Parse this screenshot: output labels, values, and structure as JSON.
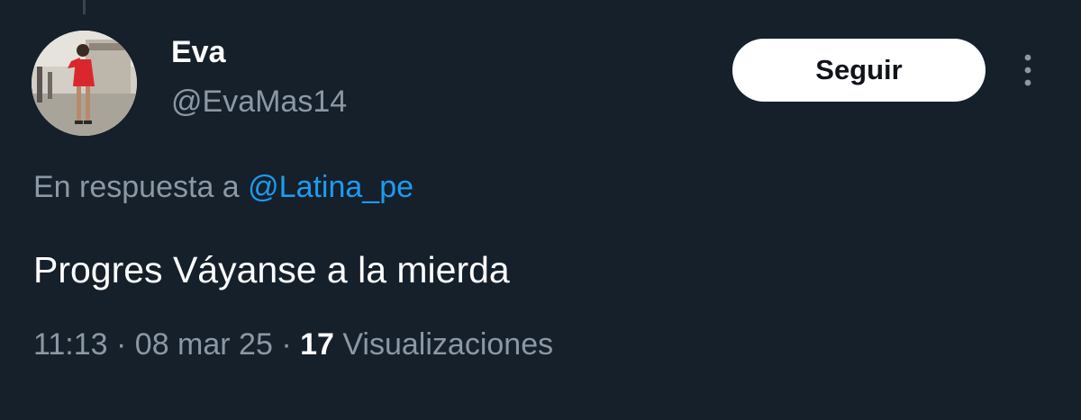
{
  "author": {
    "display_name": "Eva",
    "handle": "@EvaMas14",
    "avatar_icon": "profile-photo"
  },
  "actions": {
    "follow_label": "Seguir",
    "more_icon": "more-vertical-icon"
  },
  "reply": {
    "prefix": "En respuesta a ",
    "to_handle": "@Latina_pe"
  },
  "tweet": {
    "text": "Progres Váyanse a la mierda"
  },
  "meta": {
    "time": "11:13",
    "separator": " · ",
    "date": "08 mar 25",
    "views_count": "17",
    "views_label": " Visualizaciones"
  },
  "colors": {
    "background": "#15202b",
    "secondary_text": "#8b98a5",
    "link": "#1d9bf0",
    "primary_text": "#ffffff"
  }
}
